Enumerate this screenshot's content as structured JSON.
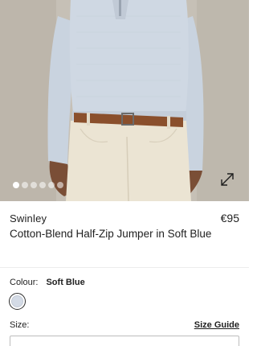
{
  "gallery": {
    "dots_total": 6,
    "active_index": 0
  },
  "product": {
    "brand": "Swinley",
    "price": "€95",
    "title": "Cotton-Blend Half-Zip Jumper in Soft Blue"
  },
  "colour": {
    "label": "Colour:",
    "value": "Soft Blue",
    "swatch_color": "#d4dbe6"
  },
  "size": {
    "label": "Size:",
    "guide_label": "Size Guide"
  },
  "icons": {
    "expand": "expand-arrows-icon"
  }
}
